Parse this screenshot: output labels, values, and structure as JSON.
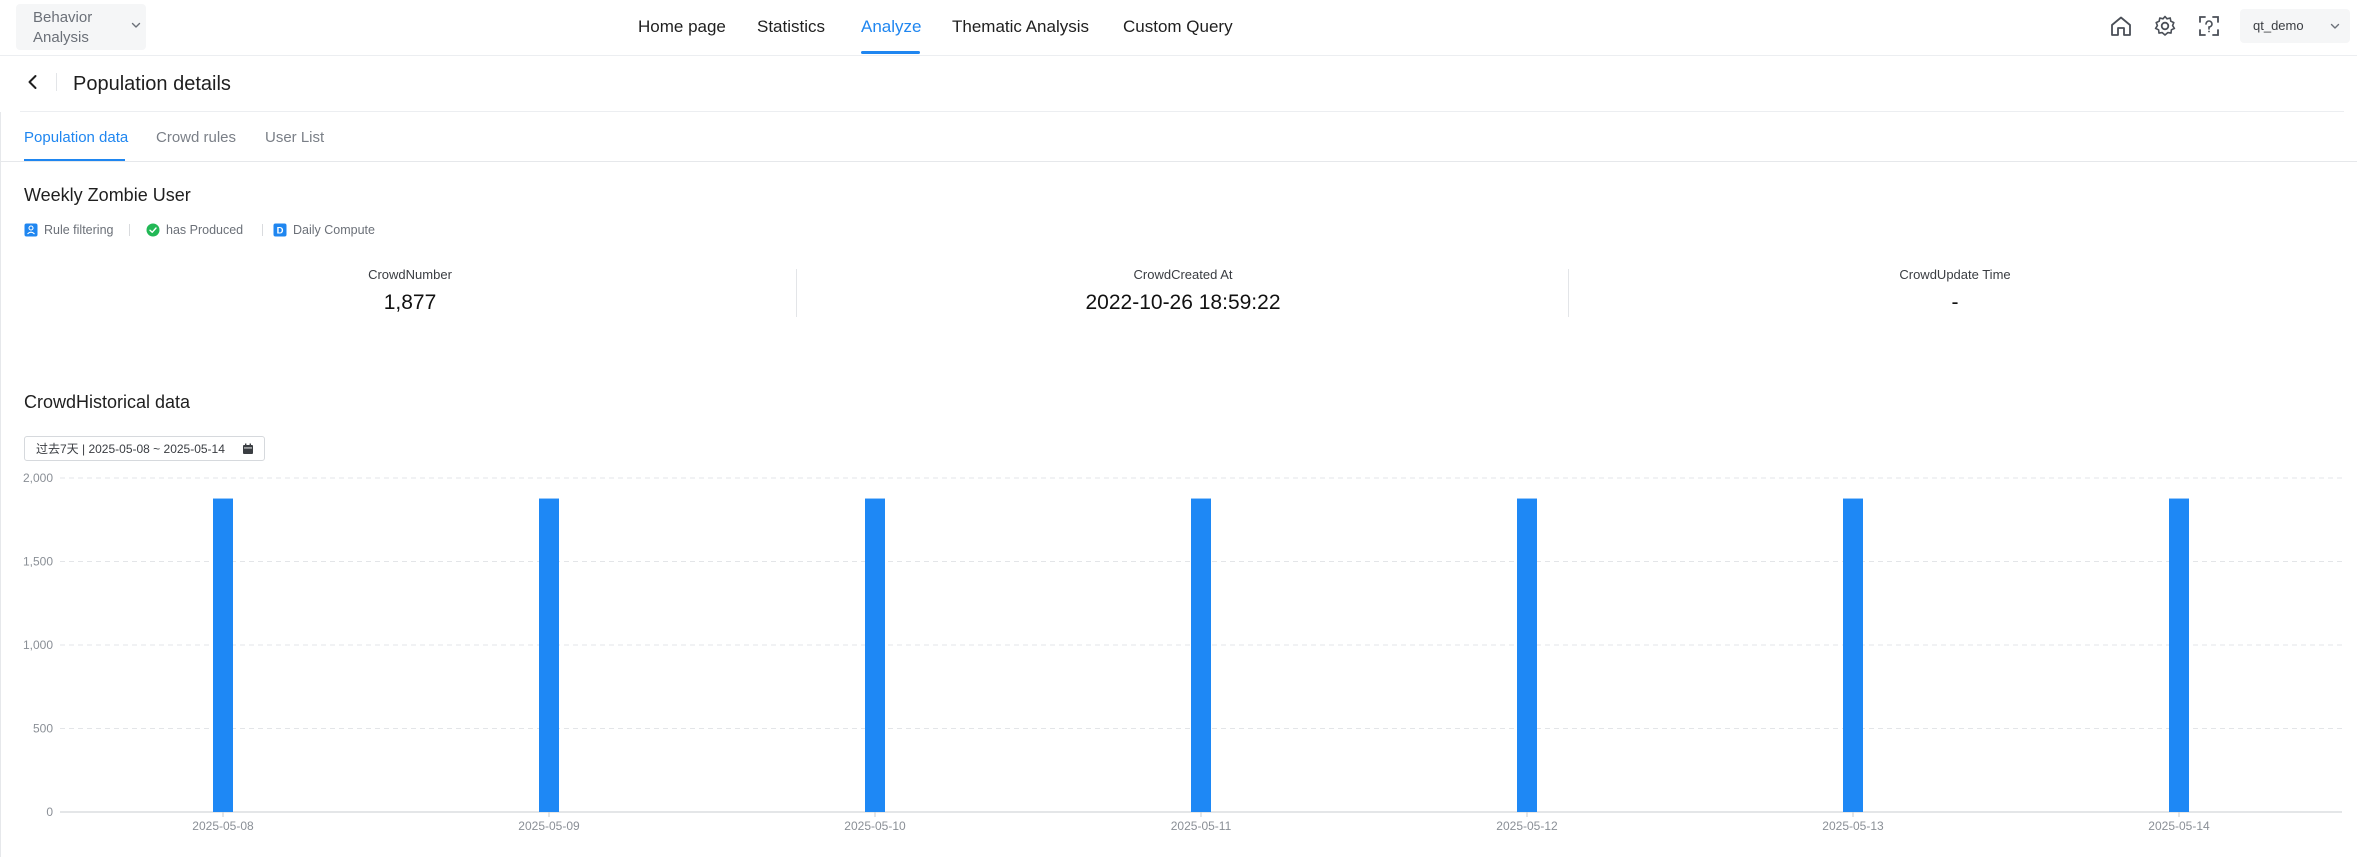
{
  "app_switcher": {
    "label": "Behavior Analysis",
    "icon": "chevron-down-icon"
  },
  "nav": {
    "items": [
      {
        "label": "Home page"
      },
      {
        "label": "Statistics"
      },
      {
        "label": "Analyze",
        "active": true
      },
      {
        "label": "Thematic Analysis"
      },
      {
        "label": "Custom Query"
      }
    ]
  },
  "toolbar": {
    "icons": [
      "home-icon",
      "gear-icon",
      "scan-icon"
    ],
    "user": "qt_demo"
  },
  "page": {
    "title": "Population details",
    "back_icon": "chevron-left-icon"
  },
  "tabs": [
    {
      "label": "Population data",
      "active": true
    },
    {
      "label": "Crowd rules"
    },
    {
      "label": "User List"
    }
  ],
  "crowd": {
    "name": "Weekly Zombie User",
    "tags": [
      {
        "label": "Rule filtering",
        "icon": "user-rule-icon"
      },
      {
        "label": "has Produced",
        "icon": "check-circle-icon"
      },
      {
        "label": "Daily Compute",
        "icon": "d-badge-icon"
      }
    ],
    "stats": [
      {
        "label": "CrowdNumber",
        "value": "1,877"
      },
      {
        "label": "CrowdCreated At",
        "value": "2022-10-26 18:59:22"
      },
      {
        "label": "CrowdUpdate Time",
        "value": "-"
      }
    ]
  },
  "history": {
    "title": "CrowdHistorical data",
    "date_range": "过去7天 | 2025-05-08 ~ 2025-05-14"
  },
  "colors": {
    "accent": "#1f86f0",
    "bar": "#1e88f5",
    "success": "#22b856"
  },
  "chart_data": {
    "type": "bar",
    "categories": [
      "2025-05-08",
      "2025-05-09",
      "2025-05-10",
      "2025-05-11",
      "2025-05-12",
      "2025-05-13",
      "2025-05-14"
    ],
    "values": [
      1877,
      1877,
      1877,
      1877,
      1877,
      1877,
      1877
    ],
    "yticks": [
      0,
      500,
      1000,
      1500,
      2000
    ],
    "ytick_labels": [
      "0",
      "500",
      "1,000",
      "1,500",
      "2,000"
    ],
    "ylim": [
      0,
      2000
    ],
    "grid": true,
    "legend": false
  }
}
